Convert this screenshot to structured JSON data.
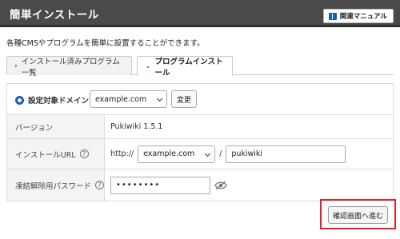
{
  "header": {
    "title": "簡単インストール",
    "manual_button": "関連マニュアル",
    "manual_icon": "book-icon"
  },
  "description": "各種CMSやプログラムを簡単に設置することができます。",
  "tabs": [
    {
      "label": "インストール済みプログラム一覧",
      "icon": "chevron-right-icon",
      "active": false
    },
    {
      "label": "プログラムインストール",
      "icon": "chevron-down-icon",
      "active": true
    }
  ],
  "form": {
    "domain": {
      "label": "設定対象ドメイン",
      "selected": "example.com",
      "change_button": "変更"
    },
    "version": {
      "label": "バージョン",
      "value": "Pukiwiki 1.5.1"
    },
    "url": {
      "label": "インストールURL",
      "help": "?",
      "scheme": "http://",
      "domain_selected": "example.com",
      "separator": "/",
      "path_value": "pukiwiki"
    },
    "password": {
      "label": "凍結解除用パスワード",
      "help": "?",
      "value": "••••••••"
    }
  },
  "confirm_button": "確認画面へ進む",
  "colors": {
    "header_bg": "#4a4a4a",
    "accent": "#1b5fb3",
    "highlight_border": "#e0242c"
  }
}
